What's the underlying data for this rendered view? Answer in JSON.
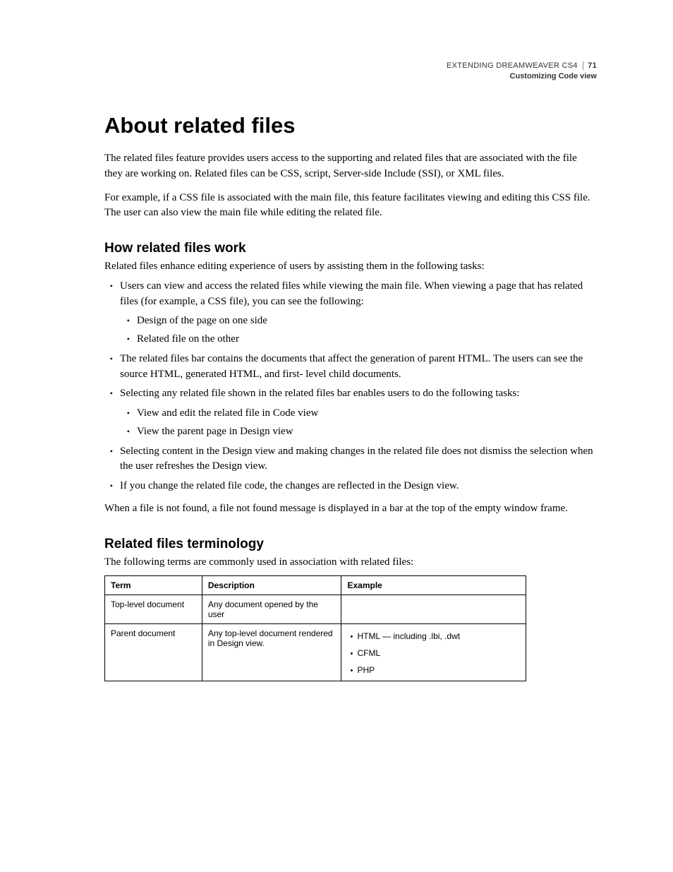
{
  "header": {
    "doc_title": "EXTENDING DREAMWEAVER CS4",
    "page_number": "71",
    "section": "Customizing Code view"
  },
  "title": "About related files",
  "intro_p1": "The related files feature provides users access to the supporting and related files that are associated with the file they are working on. Related files can be CSS, script, Server-side Include (SSI), or XML files.",
  "intro_p2": "For example, if a CSS file is associated with the main file, this feature facilitates viewing and editing this CSS file. The user can also view the main file while editing the related file.",
  "how": {
    "heading": "How related files work",
    "lead": "Related files enhance editing experience of users by assisting them in the following tasks:",
    "items": {
      "i0": "Users can view and access the related files while viewing the main file. When viewing a page that has related files (for example, a CSS file), you can see the following:",
      "i0_sub": {
        "s0": "Design of the page on one side",
        "s1": "Related file on the other"
      },
      "i1": "The related files bar contains the documents that affect the generation of parent HTML. The users can see the source HTML, generated HTML, and first- level child documents.",
      "i2": "Selecting any related file shown in the related files bar enables users to do the following tasks:",
      "i2_sub": {
        "s0": "View and edit the related file in Code view",
        "s1": "View the parent page in Design view"
      },
      "i3": "Selecting content in the Design view and making changes in the related file does not dismiss the selection when the user refreshes the Design view.",
      "i4": "If you change the related file code, the changes are reflected in the Design view."
    },
    "tail": "When a file is not found, a file not found message is displayed in a bar at the top of the empty window frame."
  },
  "terminology": {
    "heading": "Related files terminology",
    "lead": "The following terms are commonly used in association with related files:",
    "cols": {
      "c0": "Term",
      "c1": "Description",
      "c2": "Example"
    },
    "rows": {
      "r0": {
        "term": "Top-level document",
        "desc": "Any document opened by the user",
        "ex": ""
      },
      "r1": {
        "term": "Parent document",
        "desc": "Any top-level document rendered in Design view.",
        "ex": {
          "e0": "HTML — including .lbi, .dwt",
          "e1": "CFML",
          "e2": "PHP"
        }
      }
    }
  }
}
